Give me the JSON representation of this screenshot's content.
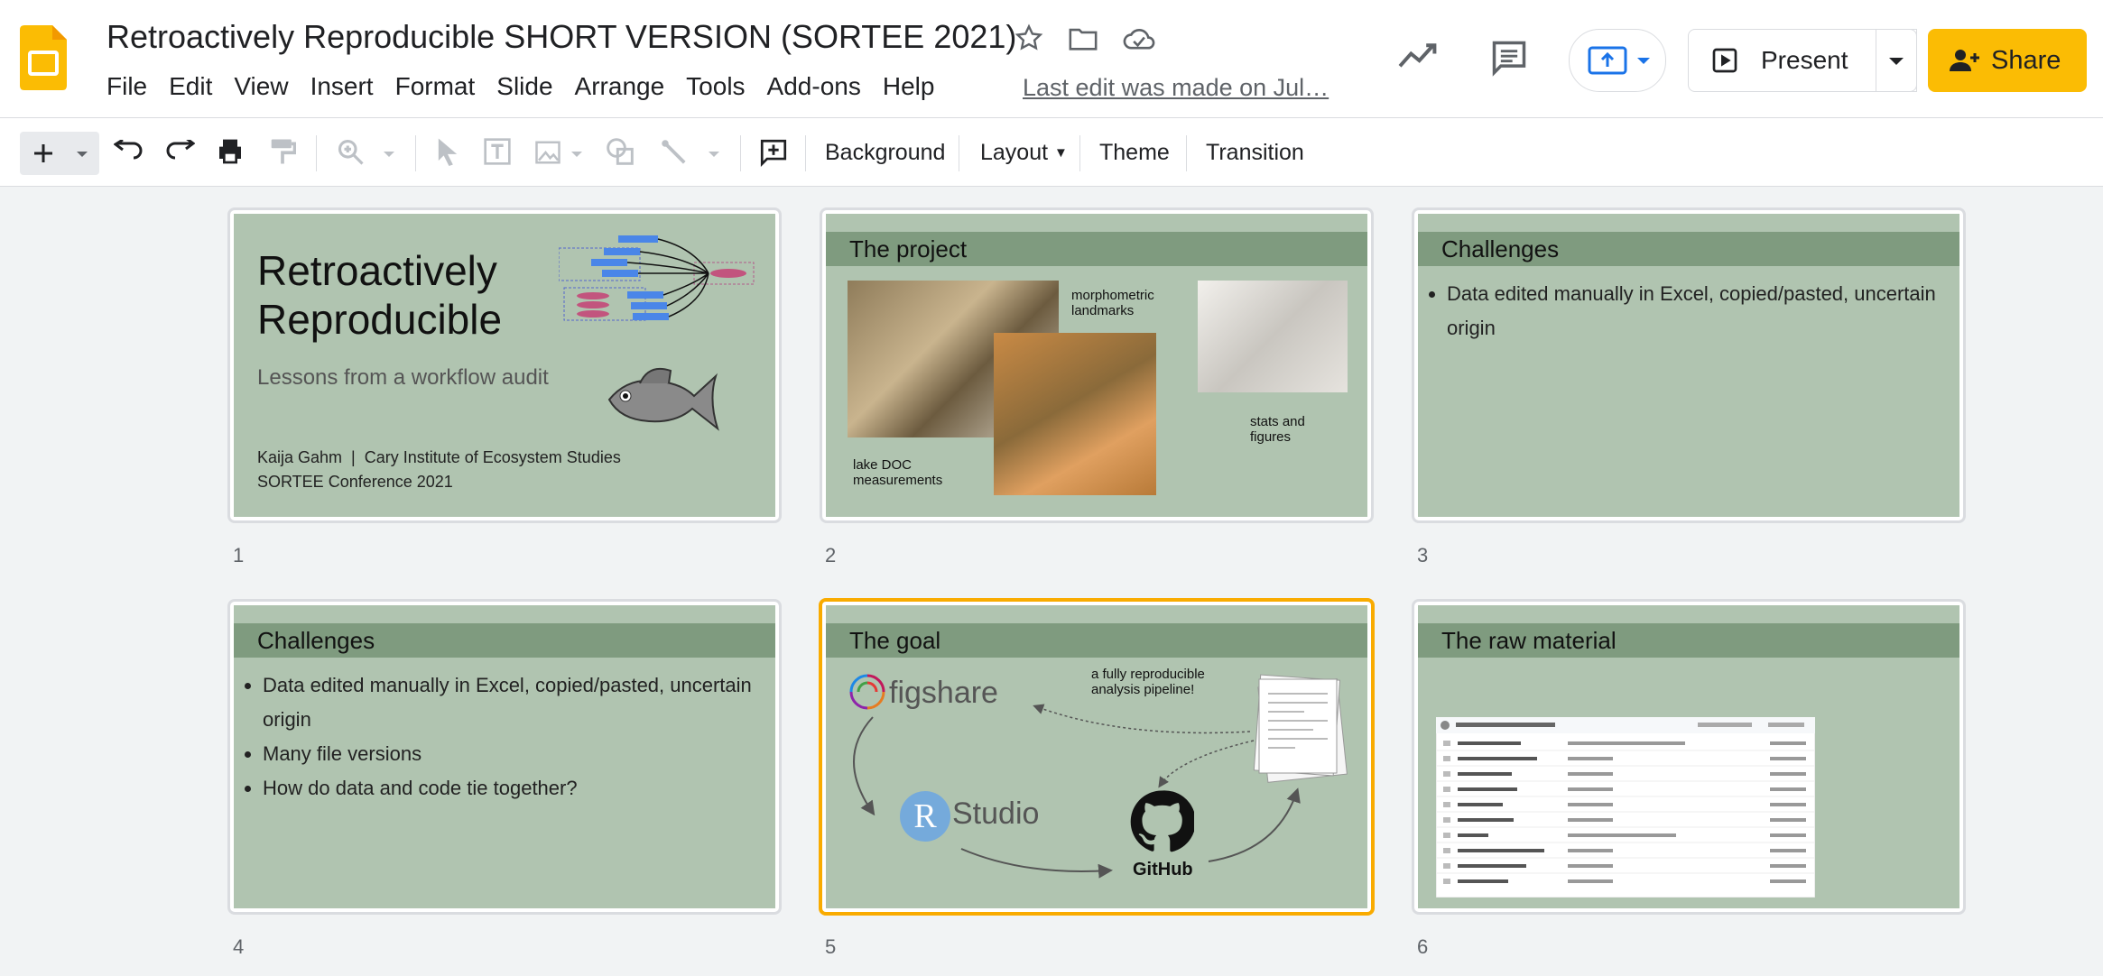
{
  "app": {
    "name": "Google Slides",
    "brand_color": "#fbbc04"
  },
  "document": {
    "title": "Retroactively Reproducible SHORT VERSION (SORTEE 2021)",
    "last_edit": "Last edit was made on Jul…"
  },
  "menu": [
    "File",
    "Edit",
    "View",
    "Insert",
    "Format",
    "Slide",
    "Arrange",
    "Tools",
    "Add-ons",
    "Help"
  ],
  "header_buttons": {
    "present": "Present",
    "share": "Share"
  },
  "toolbar": {
    "background": "Background",
    "layout": "Layout",
    "theme": "Theme",
    "transition": "Transition"
  },
  "slides": [
    {
      "number": "1",
      "title_line1": "Retroactively",
      "title_line2": "Reproducible",
      "subtitle": "Lessons from a workflow audit",
      "author": "Kaija Gahm  |  Cary Institute of Ecosystem Studies",
      "event": "SORTEE Conference 2021"
    },
    {
      "number": "2",
      "title": "The project",
      "labels": {
        "morphometric": "morphometric landmarks",
        "stats": "stats and figures",
        "doc": "lake DOC measurements"
      }
    },
    {
      "number": "3",
      "title": "Challenges",
      "bullets": [
        "Data edited manually in Excel, copied/pasted, uncertain origin"
      ]
    },
    {
      "number": "4",
      "title": "Challenges",
      "bullets": [
        "Data edited manually in Excel, copied/pasted, uncertain origin",
        "Many file versions",
        "How do data and code tie together?"
      ]
    },
    {
      "number": "5",
      "title": "The goal",
      "annotation": "a fully reproducible analysis pipeline!",
      "logos": {
        "figshare": "figshare",
        "rstudio_r": "R",
        "rstudio": "Studio",
        "github": "GitHub"
      },
      "selected": true
    },
    {
      "number": "6",
      "title": "The raw material"
    }
  ]
}
